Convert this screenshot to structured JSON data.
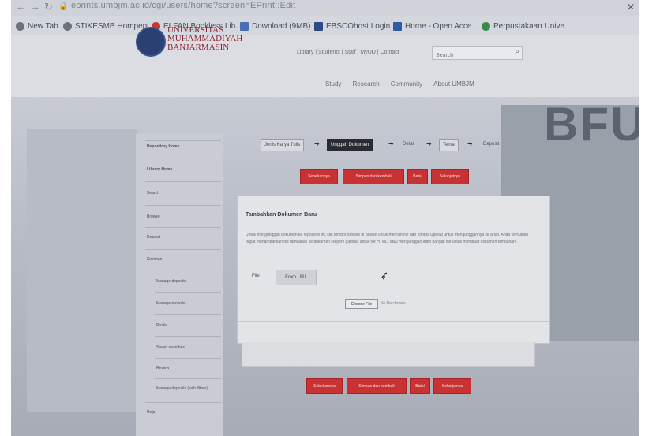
{
  "browser": {
    "url": "eprints.umbjm.ac.id/cgi/users/home?screen=EPrint::Edit",
    "bookmarks": [
      "New Tab",
      "STIKESMB Hompepi...",
      "ELFAN Bookless Lib...",
      "Download (9MB)",
      "EBSCOhost Login",
      "Home - Open Acce...",
      "Perpustakaan Unive..."
    ],
    "bookmark_colors": [
      "#6d727c",
      "#6d727c",
      "#c33a2e",
      "#4b6fb5",
      "#2c4a86",
      "#2a5caa",
      "#3a8a4f"
    ]
  },
  "site": {
    "logo_lines": [
      "UNIVERSITAS",
      "MUHAMMADIYAH",
      "BANJARMASIN"
    ],
    "top_links": "Library | Students | Staff | MyUD | Contact",
    "search_placeholder": "Search",
    "nav": [
      "Study",
      "Research",
      "Community",
      "About UMBJM"
    ]
  },
  "sidebar": {
    "items": [
      "Repository Home",
      "Library Home",
      "Search",
      "Browse",
      "Deposit",
      "Kirimkan",
      "Manage deposits",
      "Manage records",
      "Profile",
      "Saved searches",
      "Review",
      "Manage deposits (with filters)",
      "Help"
    ]
  },
  "steps": {
    "items": [
      "Jenis Karya Tulis",
      "Unggah Dokumen",
      "Detail",
      "Tema",
      "Deposit"
    ],
    "active_index": 1
  },
  "buttons": {
    "prev": "Sebelumnya",
    "save_back": "Simpan dan kembali",
    "cancel": "Batal",
    "next": "Selanjutnya"
  },
  "panel": {
    "title": "Tambahkan Dokumen Baru",
    "description": "Untuk mengunggah dokumen ke repositori ini, klik tombol Browse di bawah untuk memilih file dan tombol Upload untuk mengunggahnya ke arsip. Anda kemudian dapat menambahkan file tambahan ke dokumen (seperti gambar untuk file HTML) atau mengunggah lebih banyak file untuk membuat dokumen tambahan.",
    "tab_file": "File",
    "tab_url": "From URL",
    "choose_file": "Choose File",
    "no_file": "No file chosen"
  },
  "hero": {
    "building_text": "BFU"
  },
  "colors": {
    "accent_red": "#c93232",
    "logo_red": "#8b2231",
    "logo_blue": "#2c3f73"
  }
}
